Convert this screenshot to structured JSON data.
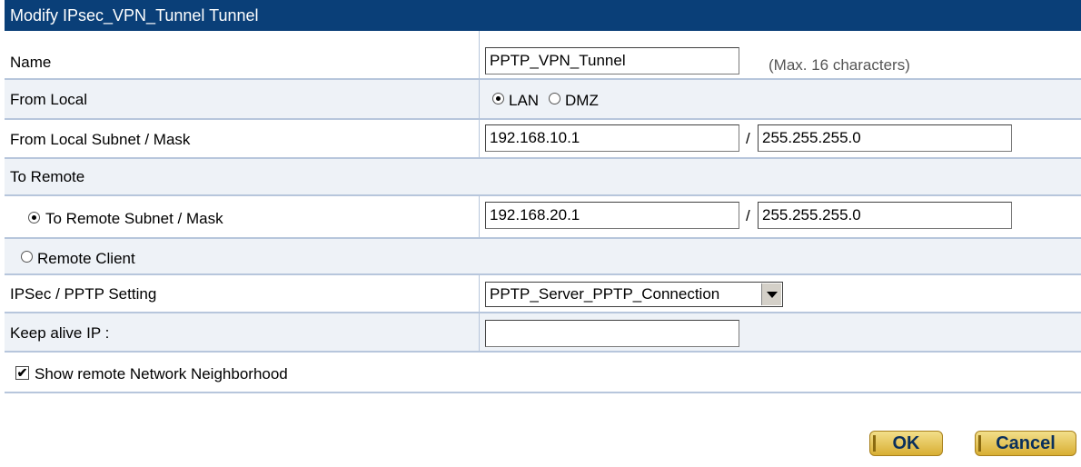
{
  "header": {
    "title": "Modify IPsec_VPN_Tunnel Tunnel"
  },
  "name": {
    "label": "Name",
    "value": "PPTP_VPN_Tunnel",
    "hint": "(Max. 16 characters)"
  },
  "from_local": {
    "label": "From Local",
    "options": [
      {
        "label": "LAN",
        "selected": true
      },
      {
        "label": "DMZ",
        "selected": false
      }
    ]
  },
  "from_local_subnet": {
    "label": "From Local Subnet / Mask",
    "subnet": "192.168.10.1",
    "separator": "/",
    "mask": "255.255.255.0"
  },
  "to_remote": {
    "label": "To Remote"
  },
  "to_remote_subnet": {
    "label": "To Remote Subnet / Mask",
    "selected": true,
    "subnet": "192.168.20.1",
    "separator": "/",
    "mask": "255.255.255.0"
  },
  "remote_client": {
    "label": "Remote Client",
    "selected": false
  },
  "ipsec_pptp": {
    "label": "IPSec / PPTP Setting",
    "value": "PPTP_Server_PPTP_Connection"
  },
  "keep_alive": {
    "label": "Keep alive IP :",
    "value": ""
  },
  "show_remote": {
    "label": "Show remote Network Neighborhood",
    "checked": true,
    "check_glyph": "✔"
  },
  "buttons": {
    "ok": "OK",
    "cancel": "Cancel"
  }
}
